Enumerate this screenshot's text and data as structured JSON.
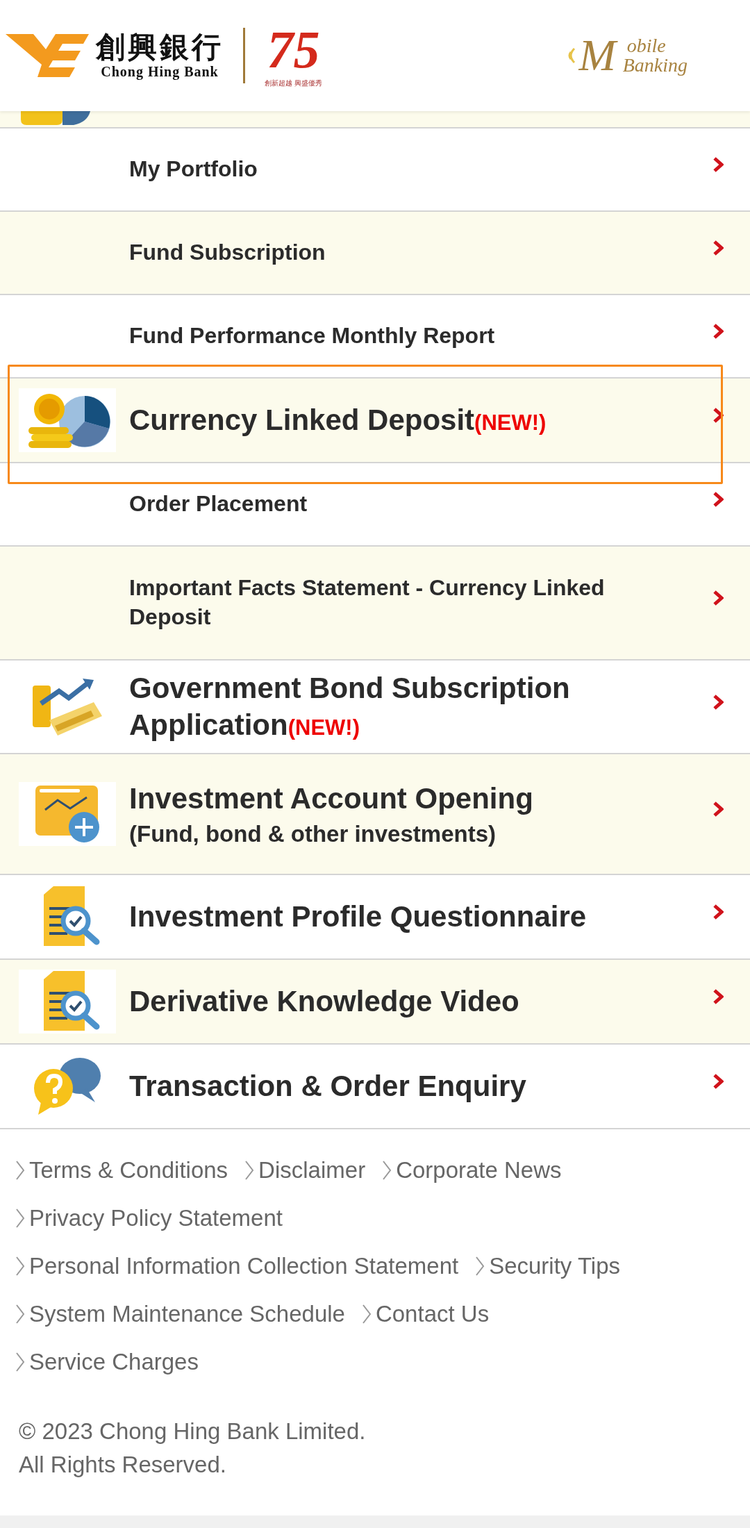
{
  "header": {
    "bank_name_chinese": "創興銀行",
    "bank_name": "Chong Hing Bank",
    "anniversary": "75",
    "anniversary_slogan": "創新超越 興盛優秀",
    "app_logo_top": "obile",
    "app_logo_bottom": "Banking",
    "app_logo_initial": "M"
  },
  "menu": [
    {
      "kind": "partial"
    },
    {
      "kind": "sub",
      "title": "My Portfolio"
    },
    {
      "kind": "sub",
      "title": "Fund Subscription"
    },
    {
      "kind": "sub",
      "title": "Fund Performance Monthly Report"
    },
    {
      "kind": "main",
      "title": "Currency Linked Deposit",
      "badge": "(NEW!)",
      "highlighted": true
    },
    {
      "kind": "sub",
      "title": "Order Placement"
    },
    {
      "kind": "sub",
      "title": "Important Facts Statement - Currency Linked Deposit"
    },
    {
      "kind": "main",
      "title": "Government Bond Subscription Application",
      "badge": "(NEW!)",
      "highlighted": false
    },
    {
      "kind": "main",
      "title": "Investment Account Opening",
      "subtitle": "(Fund, bond & other investments)",
      "highlighted": false
    },
    {
      "kind": "main",
      "title": "Investment Profile Questionnaire",
      "highlighted": false
    },
    {
      "kind": "main",
      "title": "Derivative Knowledge Video",
      "highlighted": false
    },
    {
      "kind": "main",
      "title": "Transaction & Order Enquiry",
      "highlighted": false
    }
  ],
  "footer_links": [
    [
      "Terms & Conditions",
      "Disclaimer",
      "Corporate News"
    ],
    [
      "Privacy Policy Statement"
    ],
    [
      "Personal Information Collection Statement",
      "Security Tips"
    ],
    [
      "System Maintenance Schedule",
      "Contact Us"
    ],
    [
      "Service Charges"
    ]
  ],
  "copyright": [
    "© 2023 Chong Hing Bank Limited.",
    "All Rights Reserved."
  ]
}
